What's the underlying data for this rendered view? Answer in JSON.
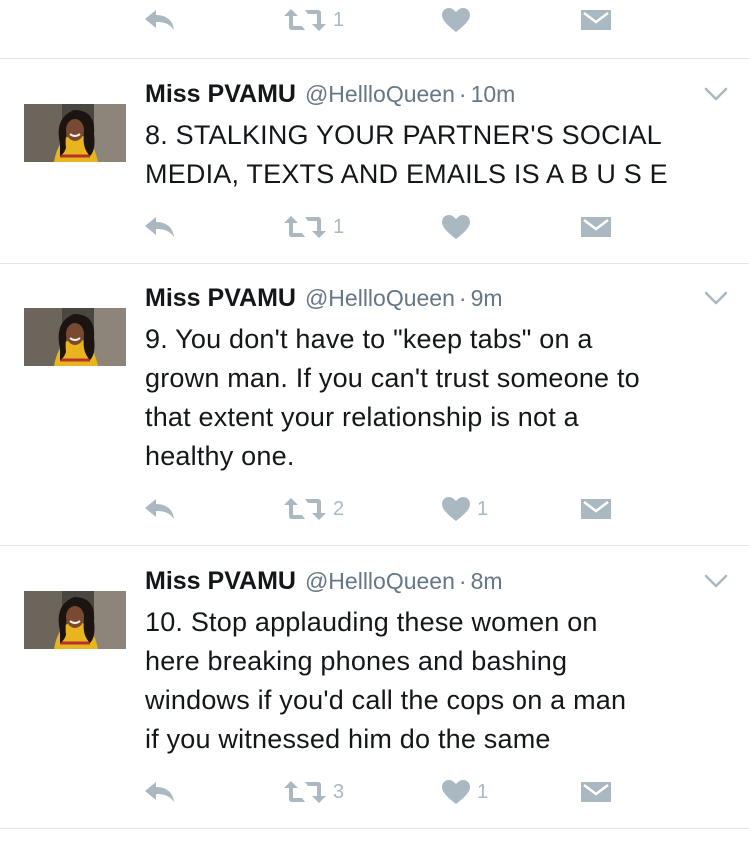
{
  "top_actions": {
    "reply_icon": "reply-icon",
    "retweet_icon": "retweet-icon",
    "retweet_count": "1",
    "like_icon": "heart-icon",
    "like_count": "",
    "dm_icon": "envelope-icon"
  },
  "tweets": [
    {
      "name": "Miss PVAMU",
      "handle": "@HellloQueen",
      "separator": "·",
      "time": "10m",
      "text_lines": [
        "8. STALKING YOUR PARTNER'S SOCIAL",
        "MEDIA, TEXTS AND EMAILS IS A B U S E"
      ],
      "retweet_count": "1",
      "like_count": ""
    },
    {
      "name": "Miss PVAMU",
      "handle": "@HellloQueen",
      "separator": "·",
      "time": "9m",
      "text_lines": [
        "9. You don't have to \"keep tabs\" on a",
        "grown man. If you can't trust someone to",
        "that extent your relationship is not a",
        "healthy one."
      ],
      "retweet_count": "2",
      "like_count": "1"
    },
    {
      "name": "Miss PVAMU",
      "handle": "@HellloQueen",
      "separator": "·",
      "time": "8m",
      "text_lines": [
        "10. Stop applauding these women on",
        "here breaking phones and bashing",
        "windows if you'd call the cops on a man",
        "if you witnessed him do the same"
      ],
      "retweet_count": "3",
      "like_count": "1"
    }
  ],
  "colors": {
    "icon": "#aab8c2",
    "muted_text": "#657786",
    "text": "#14171a",
    "divider": "#e1e8ed",
    "avatar_shirt": "#e8b51e"
  }
}
